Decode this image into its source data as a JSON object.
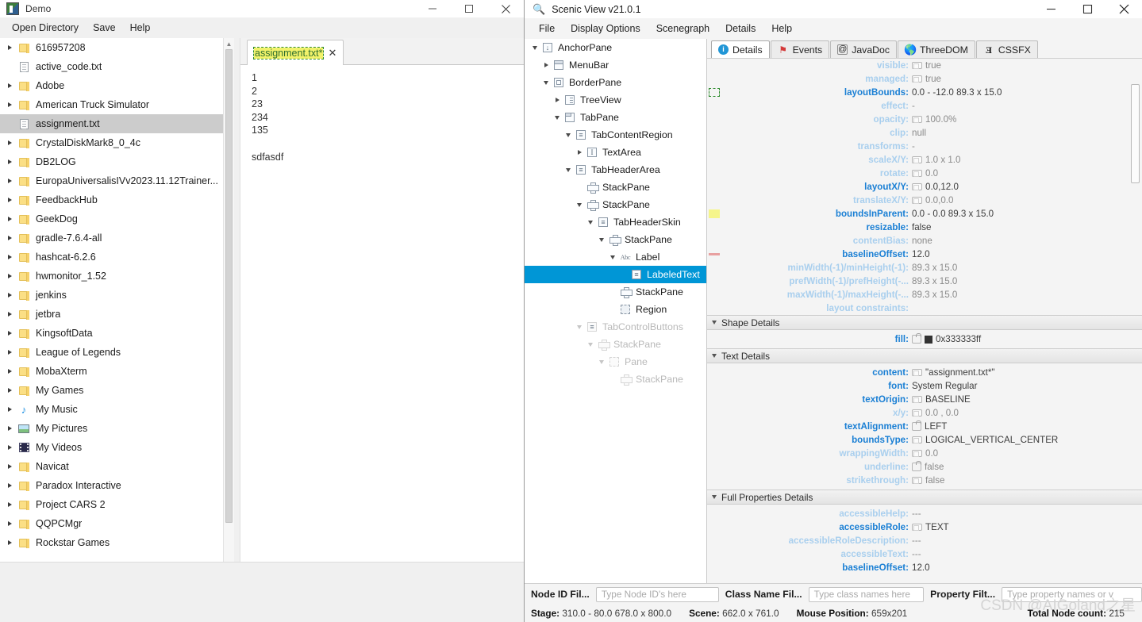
{
  "demo_window": {
    "title": "Demo",
    "window_controls": {
      "minimize": "—",
      "maximize": "□",
      "close": "✕"
    },
    "menu": [
      "Open Directory",
      "Save",
      "Help"
    ],
    "file_tree": [
      {
        "label": "616957208",
        "icon": "folder-icon",
        "expandable": true,
        "selected": false
      },
      {
        "label": "active_code.txt",
        "icon": "file-icon",
        "expandable": false,
        "selected": false
      },
      {
        "label": "Adobe",
        "icon": "folder-icon",
        "expandable": true,
        "selected": false
      },
      {
        "label": "American Truck Simulator",
        "icon": "folder-icon",
        "expandable": true,
        "selected": false
      },
      {
        "label": "assignment.txt",
        "icon": "file-icon",
        "expandable": false,
        "selected": true
      },
      {
        "label": "CrystalDiskMark8_0_4c",
        "icon": "folder-icon",
        "expandable": true,
        "selected": false
      },
      {
        "label": "DB2LOG",
        "icon": "folder-icon",
        "expandable": true,
        "selected": false
      },
      {
        "label": "EuropaUniversalisIVv2023.11.12Trainer...",
        "icon": "folder-icon",
        "expandable": true,
        "selected": false
      },
      {
        "label": "FeedbackHub",
        "icon": "folder-icon",
        "expandable": true,
        "selected": false
      },
      {
        "label": "GeekDog",
        "icon": "folder-icon",
        "expandable": true,
        "selected": false
      },
      {
        "label": "gradle-7.6.4-all",
        "icon": "folder-icon",
        "expandable": true,
        "selected": false
      },
      {
        "label": "hashcat-6.2.6",
        "icon": "folder-icon",
        "expandable": true,
        "selected": false
      },
      {
        "label": "hwmonitor_1.52",
        "icon": "folder-icon",
        "expandable": true,
        "selected": false
      },
      {
        "label": "jenkins",
        "icon": "folder-icon",
        "expandable": true,
        "selected": false
      },
      {
        "label": "jetbra",
        "icon": "folder-icon",
        "expandable": true,
        "selected": false
      },
      {
        "label": "KingsoftData",
        "icon": "folder-icon",
        "expandable": true,
        "selected": false
      },
      {
        "label": "League of Legends",
        "icon": "folder-icon",
        "expandable": true,
        "selected": false
      },
      {
        "label": "MobaXterm",
        "icon": "folder-icon",
        "expandable": true,
        "selected": false
      },
      {
        "label": "My Games",
        "icon": "folder-icon",
        "expandable": true,
        "selected": false
      },
      {
        "label": "My Music",
        "icon": "music-icon",
        "expandable": true,
        "selected": false
      },
      {
        "label": "My Pictures",
        "icon": "pictures-icon",
        "expandable": true,
        "selected": false
      },
      {
        "label": "My Videos",
        "icon": "video-icon",
        "expandable": true,
        "selected": false
      },
      {
        "label": "Navicat",
        "icon": "folder-icon",
        "expandable": true,
        "selected": false
      },
      {
        "label": "Paradox Interactive",
        "icon": "folder-icon",
        "expandable": true,
        "selected": false
      },
      {
        "label": "Project CARS 2",
        "icon": "folder-icon",
        "expandable": true,
        "selected": false
      },
      {
        "label": "QQPCMgr",
        "icon": "folder-icon",
        "expandable": true,
        "selected": false
      },
      {
        "label": "Rockstar Games",
        "icon": "folder-icon",
        "expandable": true,
        "selected": false
      }
    ],
    "editor": {
      "tab_label": "assignment.txt*",
      "tab_close": "✕",
      "content": "1\n2\n23\n234\n135\n\nsdfasdf"
    }
  },
  "scenic_view": {
    "title": "Scenic View v21.0.1",
    "title_icon": "magnifier-icon",
    "window_controls": {
      "minimize": "—",
      "maximize": "□",
      "close": "✕"
    },
    "menu": [
      "File",
      "Display Options",
      "Scenegraph",
      "Details",
      "Help"
    ],
    "scene_tree": [
      {
        "label": "AnchorPane",
        "indent": 0,
        "toggle": "down",
        "icon": "anchorpane-icon",
        "dim": false,
        "selected": false
      },
      {
        "label": "MenuBar",
        "indent": 1,
        "toggle": "right",
        "icon": "menubar-icon",
        "dim": false,
        "selected": false
      },
      {
        "label": "BorderPane",
        "indent": 1,
        "toggle": "down",
        "icon": "borderpane-icon",
        "dim": false,
        "selected": false
      },
      {
        "label": "TreeView",
        "indent": 2,
        "toggle": "right",
        "icon": "treeview-icon",
        "dim": false,
        "selected": false
      },
      {
        "label": "TabPane",
        "indent": 2,
        "toggle": "down",
        "icon": "tabpane-icon",
        "dim": false,
        "selected": false
      },
      {
        "label": "TabContentRegion",
        "indent": 3,
        "toggle": "down",
        "icon": "skin-region-icon",
        "dim": false,
        "selected": false
      },
      {
        "label": "TextArea",
        "indent": 4,
        "toggle": "right",
        "icon": "textarea-icon",
        "dim": false,
        "selected": false
      },
      {
        "label": "TabHeaderArea",
        "indent": 3,
        "toggle": "down",
        "icon": "skin-region-icon",
        "dim": false,
        "selected": false
      },
      {
        "label": "StackPane",
        "indent": 4,
        "toggle": "none",
        "icon": "stackpane-icon",
        "dim": false,
        "selected": false
      },
      {
        "label": "StackPane",
        "indent": 4,
        "toggle": "down",
        "icon": "stackpane-icon",
        "dim": false,
        "selected": false
      },
      {
        "label": "TabHeaderSkin",
        "indent": 5,
        "toggle": "down",
        "icon": "skin-region-icon",
        "dim": false,
        "selected": false
      },
      {
        "label": "StackPane",
        "indent": 6,
        "toggle": "down",
        "icon": "stackpane-icon",
        "dim": false,
        "selected": false
      },
      {
        "label": "Label",
        "indent": 7,
        "toggle": "down",
        "icon": "abc-label-icon",
        "dim": false,
        "selected": false
      },
      {
        "label": "LabeledText",
        "indent": 8,
        "toggle": "none",
        "icon": "skin-region-icon",
        "dim": false,
        "selected": true
      },
      {
        "label": "StackPane",
        "indent": 7,
        "toggle": "none",
        "icon": "stackpane-icon",
        "dim": false,
        "selected": false
      },
      {
        "label": "Region",
        "indent": 7,
        "toggle": "none",
        "icon": "region-icon",
        "dim": false,
        "selected": false
      },
      {
        "label": "TabControlButtons",
        "indent": 4,
        "toggle": "down",
        "icon": "skin-region-icon",
        "dim": true,
        "selected": false
      },
      {
        "label": "StackPane",
        "indent": 5,
        "toggle": "down",
        "icon": "stackpane-icon",
        "dim": true,
        "selected": false
      },
      {
        "label": "Pane",
        "indent": 6,
        "toggle": "down",
        "icon": "region-icon",
        "dim": true,
        "selected": false
      },
      {
        "label": "StackPane",
        "indent": 7,
        "toggle": "none",
        "icon": "stackpane-icon",
        "dim": true,
        "selected": false
      }
    ],
    "tabs": [
      {
        "label": "Details",
        "icon": "info-icon",
        "active": true
      },
      {
        "label": "Events",
        "icon": "flag-icon",
        "active": false
      },
      {
        "label": "JavaDoc",
        "icon": "at-icon",
        "active": false
      },
      {
        "label": "ThreeDOM",
        "icon": "globe-icon",
        "active": false
      },
      {
        "label": "CSSFX",
        "icon": "css3-icon",
        "active": false
      }
    ],
    "properties": [
      {
        "key": "visible:",
        "value": "true",
        "mark": "chip",
        "keyStyle": "pale",
        "valStyle": "grey"
      },
      {
        "key": "managed:",
        "value": "true",
        "mark": "chip",
        "keyStyle": "pale",
        "valStyle": "grey"
      },
      {
        "key": "layoutBounds:",
        "value": "0.0 - -12.0  89.3 x 15.0",
        "mark": "dash-swatch",
        "keyStyle": "strong",
        "valStyle": ""
      },
      {
        "key": "effect:",
        "value": "-",
        "mark": "none",
        "keyStyle": "pale",
        "valStyle": "grey"
      },
      {
        "key": "opacity:",
        "value": "100.0%",
        "mark": "chip",
        "keyStyle": "pale",
        "valStyle": "grey"
      },
      {
        "key": "clip:",
        "value": "null",
        "mark": "none",
        "keyStyle": "pale",
        "valStyle": "grey"
      },
      {
        "key": "transforms:",
        "value": "-",
        "mark": "none",
        "keyStyle": "pale",
        "valStyle": "grey"
      },
      {
        "key": "scaleX/Y:",
        "value": "1.0 x 1.0",
        "mark": "chip",
        "keyStyle": "pale",
        "valStyle": "grey"
      },
      {
        "key": "rotate:",
        "value": "0.0",
        "mark": "chip",
        "keyStyle": "pale",
        "valStyle": "grey"
      },
      {
        "key": "layoutX/Y:",
        "value": "0.0,12.0",
        "mark": "chip",
        "keyStyle": "strong",
        "valStyle": ""
      },
      {
        "key": "translateX/Y:",
        "value": "0.0,0.0",
        "mark": "chip",
        "keyStyle": "pale",
        "valStyle": "grey"
      },
      {
        "key": "boundsInParent:",
        "value": "0.0 - 0.0  89.3 x 15.0",
        "mark": "yellow-swatch",
        "keyStyle": "strong",
        "valStyle": ""
      },
      {
        "key": "resizable:",
        "value": "false",
        "mark": "none",
        "keyStyle": "strong",
        "valStyle": ""
      },
      {
        "key": "contentBias:",
        "value": "none",
        "mark": "none",
        "keyStyle": "pale",
        "valStyle": "grey"
      },
      {
        "key": "baselineOffset:",
        "value": "12.0",
        "mark": "red-swatch",
        "keyStyle": "strong",
        "valStyle": ""
      },
      {
        "key": "minWidth(-1)/minHeight(-1):",
        "value": "89.3 x 15.0",
        "mark": "none",
        "keyStyle": "pale",
        "valStyle": "grey"
      },
      {
        "key": "prefWidth(-1)/prefHeight(-...",
        "value": "89.3 x 15.0",
        "mark": "none",
        "keyStyle": "pale",
        "valStyle": "grey"
      },
      {
        "key": "maxWidth(-1)/maxHeight(-...",
        "value": "89.3 x 15.0",
        "mark": "none",
        "keyStyle": "pale",
        "valStyle": "grey"
      },
      {
        "key": "layout constraints:",
        "value": "",
        "mark": "none",
        "keyStyle": "pale",
        "valStyle": ""
      }
    ],
    "shape_details": {
      "header": "Shape Details",
      "rows": [
        {
          "key": "fill:",
          "value": "0x333333ff",
          "mark": "lock-black",
          "keyStyle": "strong",
          "valStyle": ""
        }
      ]
    },
    "text_details": {
      "header": "Text Details",
      "rows": [
        {
          "key": "content:",
          "value": "\"assignment.txt*\"",
          "mark": "chip",
          "keyStyle": "strong",
          "valStyle": ""
        },
        {
          "key": "font:",
          "value": "System Regular",
          "mark": "none",
          "keyStyle": "strong",
          "valStyle": ""
        },
        {
          "key": "textOrigin:",
          "value": "BASELINE",
          "mark": "chip",
          "keyStyle": "strong",
          "valStyle": ""
        },
        {
          "key": "x/y:",
          "value": "0.0 , 0.0",
          "mark": "chip",
          "keyStyle": "pale",
          "valStyle": "grey"
        },
        {
          "key": "textAlignment:",
          "value": "LEFT",
          "mark": "lock",
          "keyStyle": "strong",
          "valStyle": ""
        },
        {
          "key": "boundsType:",
          "value": "LOGICAL_VERTICAL_CENTER",
          "mark": "chip",
          "keyStyle": "strong",
          "valStyle": ""
        },
        {
          "key": "wrappingWidth:",
          "value": "0.0",
          "mark": "chip",
          "keyStyle": "pale",
          "valStyle": "grey"
        },
        {
          "key": "underline:",
          "value": "false",
          "mark": "lock",
          "keyStyle": "pale",
          "valStyle": "grey"
        },
        {
          "key": "strikethrough:",
          "value": "false",
          "mark": "chip",
          "keyStyle": "pale",
          "valStyle": "grey"
        }
      ]
    },
    "full_properties": {
      "header": "Full Properties Details",
      "rows": [
        {
          "key": "accessibleHelp:",
          "value": "---",
          "mark": "none",
          "keyStyle": "pale",
          "valStyle": "grey"
        },
        {
          "key": "accessibleRole:",
          "value": "TEXT",
          "mark": "chip",
          "keyStyle": "strong",
          "valStyle": ""
        },
        {
          "key": "accessibleRoleDescription:",
          "value": "---",
          "mark": "none",
          "keyStyle": "pale",
          "valStyle": "grey"
        },
        {
          "key": "accessibleText:",
          "value": "---",
          "mark": "none",
          "keyStyle": "pale",
          "valStyle": "grey"
        },
        {
          "key": "baselineOffset:",
          "value": "12.0",
          "mark": "none",
          "keyStyle": "strong",
          "valStyle": ""
        }
      ]
    },
    "footer": {
      "node_id_filter_label": "Node ID Fil...",
      "node_id_filter_placeholder": "Type Node ID's here",
      "class_name_filter_label": "Class Name Fil...",
      "class_name_filter_placeholder": "Type class names here",
      "property_filter_label": "Property Filt...",
      "property_filter_placeholder": "Type property names or v",
      "stage_label": "Stage:",
      "stage_value": "310.0 - 80.0  678.0 x 800.0",
      "scene_label": "Scene:",
      "scene_value": "662.0 x 761.0",
      "mouse_label": "Mouse Position:",
      "mouse_value": "659x201",
      "node_count_label": "Total Node count:",
      "node_count_value": "215",
      "watermark": "CSDN @AIGoland之星"
    }
  }
}
